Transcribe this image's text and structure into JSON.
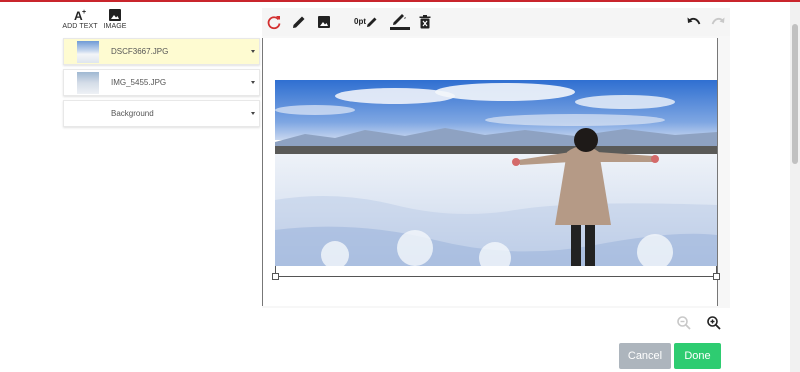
{
  "left_toolbar": {
    "add_text_label": "ADD TEXT",
    "image_label": "IMAGE"
  },
  "toolbar": {
    "stroke_size": "0pt",
    "icons": [
      "redo-reload-icon",
      "pencil-icon",
      "image-icon",
      "pen-icon",
      "border-color-icon",
      "delete-icon",
      "undo-icon",
      "redo-icon"
    ]
  },
  "layers": [
    {
      "name": "DSCF3667.JPG",
      "active": true
    },
    {
      "name": "IMG_5455.JPG",
      "active": false
    },
    {
      "name": "Background",
      "active": false
    }
  ],
  "actions": {
    "cancel_label": "Cancel",
    "done_label": "Done"
  },
  "colors": {
    "accent_red": "#c9252c",
    "done_green": "#2ecc71",
    "cancel_gray": "#adb5bd",
    "active_layer": "#fefbd1"
  }
}
